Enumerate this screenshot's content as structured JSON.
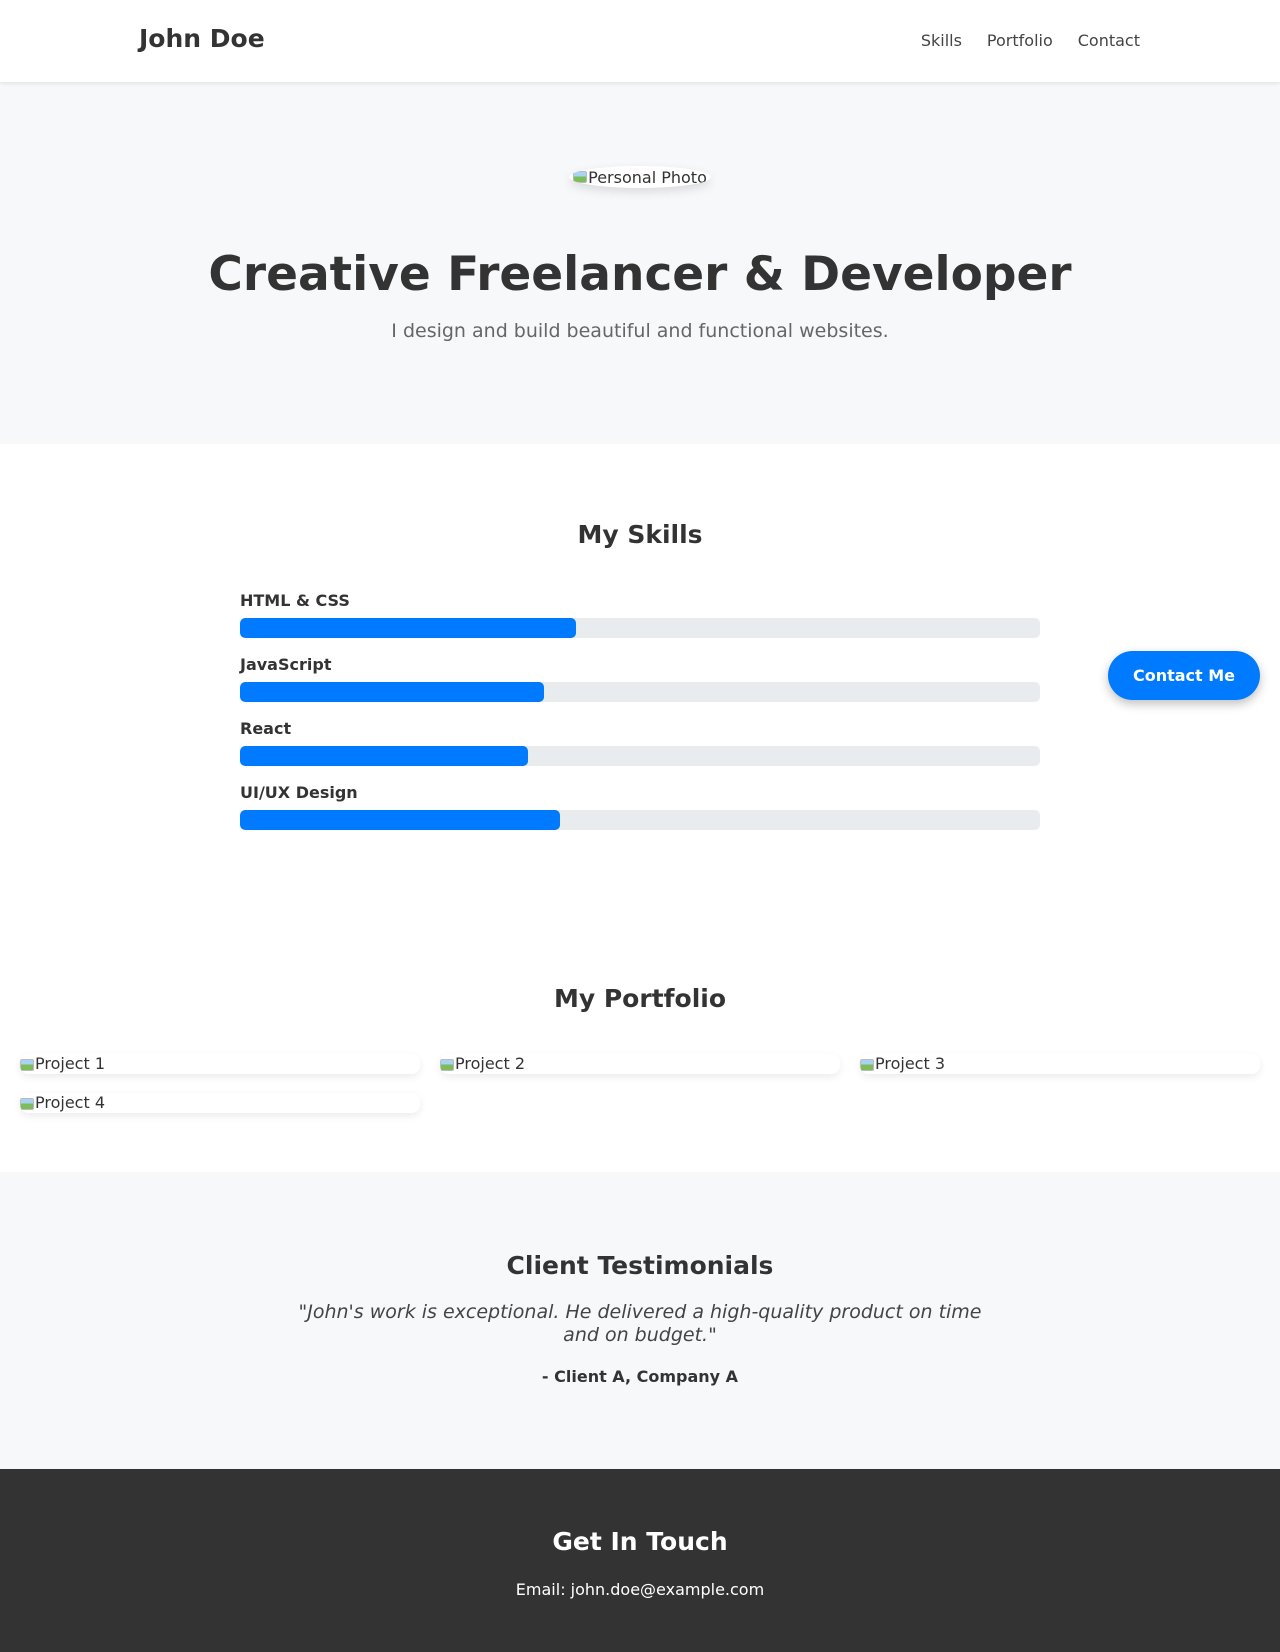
{
  "header": {
    "brand": "John Doe",
    "nav": [
      "Skills",
      "Portfolio",
      "Contact"
    ]
  },
  "hero": {
    "photo_alt": "Personal Photo",
    "title": "Creative Freelancer & Developer",
    "subtitle": "I design and build beautiful and functional websites."
  },
  "skills": {
    "title": "My Skills",
    "items": [
      {
        "label": "HTML & CSS",
        "level": 0.42
      },
      {
        "label": "JavaScript",
        "level": 0.38
      },
      {
        "label": "React",
        "level": 0.36
      },
      {
        "label": "UI/UX Design",
        "level": 0.4
      }
    ]
  },
  "contact_button": "Contact Me",
  "portfolio": {
    "title": "My Portfolio",
    "projects": [
      "Project 1",
      "Project 2",
      "Project 3",
      "Project 4"
    ]
  },
  "testimonials": {
    "title": "Client Testimonials",
    "quote": "\"John's work is exceptional. He delivered a high-quality product on time and on budget.\"",
    "author": "- Client A, Company A"
  },
  "footer": {
    "title": "Get In Touch",
    "email": "Email: john.doe@example.com"
  },
  "colors": {
    "accent": "#007bff",
    "track": "#e9ecef",
    "light_bg": "#f7f8fa",
    "footer_bg": "#333333"
  }
}
